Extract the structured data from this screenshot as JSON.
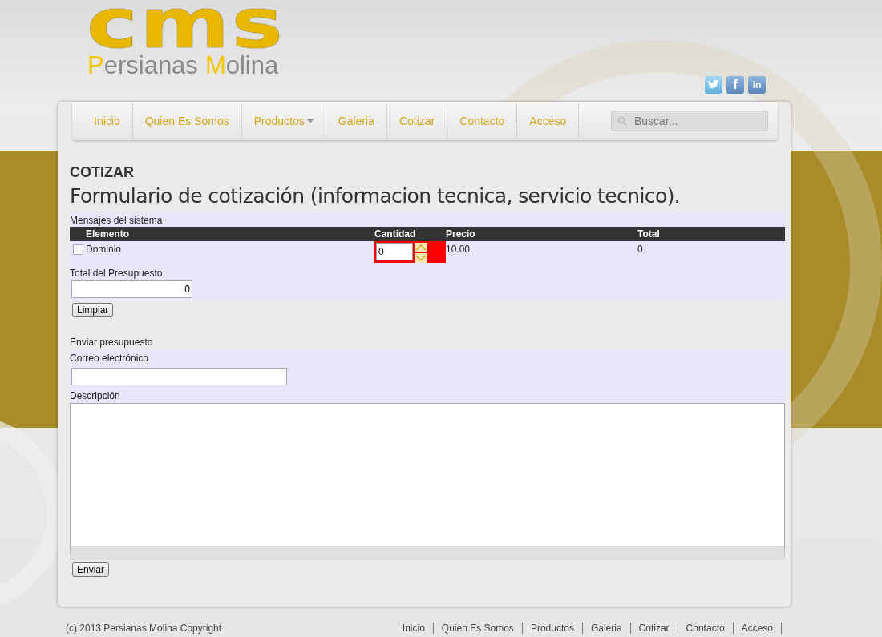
{
  "logo": {
    "mark": "cms",
    "name": [
      "Persianas",
      "Molina"
    ]
  },
  "social": [
    {
      "kind": "twitter"
    },
    {
      "kind": "facebook",
      "glyph": "f"
    },
    {
      "kind": "linkedin",
      "glyph": "in"
    }
  ],
  "nav": [
    {
      "label": "Inicio",
      "selected": false,
      "has_menu": false
    },
    {
      "label": "Quien Es Somos",
      "selected": false,
      "has_menu": false
    },
    {
      "label": "Productos",
      "selected": false,
      "has_menu": true
    },
    {
      "label": "Galeria",
      "selected": false,
      "has_menu": false
    },
    {
      "label": "Cotizar",
      "selected": false,
      "has_menu": false
    },
    {
      "label": "Contacto",
      "selected": false,
      "has_menu": false
    },
    {
      "label": "Acceso",
      "selected": false,
      "has_menu": false
    }
  ],
  "search": {
    "placeholder": "Buscar..."
  },
  "page": {
    "heading": "COTIZAR",
    "title": "Formulario de cotización (informacion tecnica, servicio tecnico)."
  },
  "quote": {
    "caption": "Mensajes del sistema",
    "columns": [
      "Elemento",
      "Cantidad",
      "Precio",
      "Total"
    ],
    "rows": [
      {
        "checked": false,
        "name": "Dominio",
        "quantity": "0",
        "price": "10.00",
        "total": "0"
      }
    ],
    "total_label": "Total del Presupuesto",
    "total_value": "0",
    "clear_button": "Limpiar"
  },
  "send": {
    "heading": "Enviar presupuesto",
    "email_label": "Correo electrónico",
    "description_label": "Descripción",
    "submit": "Enviar"
  },
  "footer": {
    "copyright": "(c) 2013 Persianas Molina Copyright",
    "links": [
      "Inicio",
      "Quien Es Somos",
      "Productos",
      "Galeria",
      "Cotizar",
      "Contacto",
      "Acceso"
    ]
  }
}
